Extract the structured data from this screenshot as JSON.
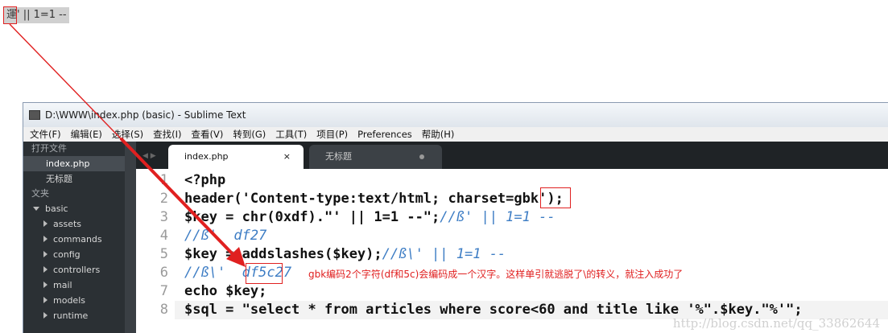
{
  "browser_output": "運' || 1=1 --",
  "window": {
    "title": "D:\\WWW\\index.php (basic) - Sublime Text"
  },
  "menu": [
    "文件(F)",
    "编辑(E)",
    "选择(S)",
    "查找(I)",
    "查看(V)",
    "转到(G)",
    "工具(T)",
    "项目(P)",
    "Preferences",
    "帮助(H)"
  ],
  "sidebar": {
    "open_files_header": "打开文件",
    "open_files": [
      "index.php",
      "无标题"
    ],
    "folders_header": "文夹",
    "root_folder": "basic",
    "subfolders": [
      "assets",
      "commands",
      "config",
      "controllers",
      "mail",
      "models",
      "runtime"
    ]
  },
  "tabs": [
    {
      "label": "index.php",
      "close": "×"
    },
    {
      "label": "无标题"
    }
  ],
  "code": {
    "line_numbers": [
      "1",
      "2",
      "3",
      "4",
      "5",
      "6",
      "7",
      "8"
    ],
    "l1": "<?php",
    "l2a": "header('Content-type:text/html; charset=",
    "l2b": "gbk",
    "l2c": "');",
    "l3a": "$key = chr(0xdf).\"' || 1=1 --\";",
    "l3b": "//ß' || 1=1 --",
    "l4": "//ß'  df27",
    "l5a": "$key = addslashes($key);",
    "l5b": "//ß\\' || 1=1 --",
    "l6a": "//ß\\'  ",
    "l6b": "df5c",
    "l6c": "27",
    "l7": "echo $key;",
    "l8": "$sql = \"select * from articles where score<60 and title like '%\".$key.\"%'\";"
  },
  "annotation": "gbk编码2个字符(df和5c)会编码成一个汉字。这样单引就逃脱了\\的转义，就注入成功了",
  "watermark": "http://blog.csdn.net/qq_33862644",
  "colors": {
    "annotation": "#e02020",
    "comment": "#3c7cc4",
    "sidebar_bg": "#2b3034"
  }
}
